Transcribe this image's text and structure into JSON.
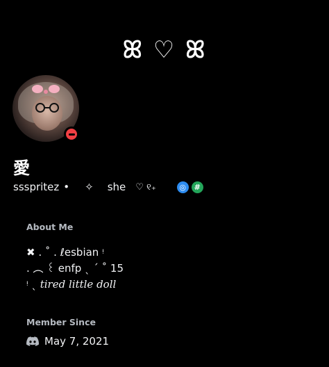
{
  "banner": {
    "text": "ꕤ ♡ ꕤ"
  },
  "profile": {
    "display_name": "愛",
    "username": "ssspritez",
    "sep1": "•",
    "sparkle": "✧",
    "pronouns": "she",
    "pronoun_deco": "♡ ୧₊",
    "status": "do-not-disturb"
  },
  "badges": [
    {
      "name": "nitro",
      "glyph": "◎"
    },
    {
      "name": "hashtag",
      "glyph": "#"
    }
  ],
  "about": {
    "title": "About Me",
    "line1": "✖  .  ˚  .  ℓesbian ᵎ",
    "line2": ".   ︵ ꒰ enfp  ˎ  ˊ  ˚ 15",
    "line3_prefix": "ᵎ ˎ",
    "line3": "tired little doll"
  },
  "member_since": {
    "title": "Member Since",
    "date": "May 7, 2021"
  },
  "colors": {
    "dnd": "#f23f43",
    "nitro": "#2d8cf0",
    "hash": "#23a55a",
    "muted": "#b5bac1"
  }
}
